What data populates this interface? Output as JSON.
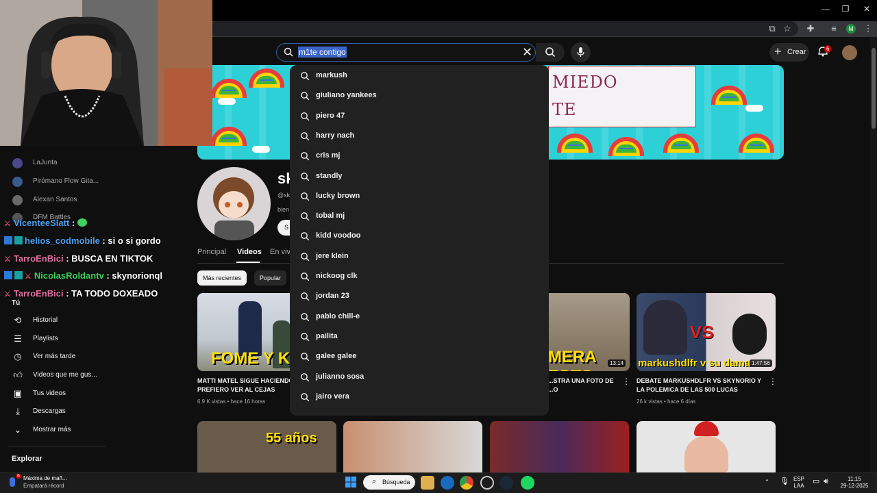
{
  "browser": {
    "window_controls": [
      "—",
      "❐",
      "✕"
    ],
    "profile_initial": "M"
  },
  "youtube": {
    "search_query": "m1te contigo",
    "create_label": "Crear",
    "notifications_count": "6"
  },
  "suggestions": [
    "markush",
    "giuliano yankees",
    "piero 47",
    "harry nach",
    "cris mj",
    "standly",
    "lucky brown",
    "tobal mj",
    "kidd voodoo",
    "jere klein",
    "nickoog clk",
    "jordan 23",
    "pablo chill-e",
    "pailita",
    "galee galee",
    "julianno sosa",
    "jairo vera"
  ],
  "banner": {
    "text_line1": "MIEDO",
    "text_line2": "TE"
  },
  "channel": {
    "name_partial": "sk",
    "handle_partial": "@sk",
    "desc_partial": "bien",
    "subscribe_partial": "S"
  },
  "tabs": [
    "Principal",
    "Videos",
    "En viv"
  ],
  "chips": [
    "Más recientes",
    "Popular"
  ],
  "sidebar": {
    "subscriptions": [
      {
        "label": "LaJunta"
      },
      {
        "label": "Pirómano Flow Gita..."
      },
      {
        "label": "Alexan Santos"
      },
      {
        "label": "DFM Battles"
      }
    ],
    "you_header": "Tú",
    "you_items": [
      {
        "label": "Historial",
        "icon": "history-icon"
      },
      {
        "label": "Playlists",
        "icon": "playlists-icon"
      },
      {
        "label": "Ver más tarde",
        "icon": "watch-later-icon"
      },
      {
        "label": "Videos que me gus...",
        "icon": "liked-icon"
      },
      {
        "label": "Tus videos",
        "icon": "your-videos-icon"
      },
      {
        "label": "Descargas",
        "icon": "downloads-icon"
      },
      {
        "label": "Mostrar más",
        "icon": "chevron-down-icon"
      }
    ],
    "explore_header": "Explorar"
  },
  "chat": [
    {
      "name": "VicenteeSlatt",
      "sep": " : ",
      "msg": ""
    },
    {
      "name": "helios_codmobile",
      "sep": " : ",
      "msg": "si o si gordo"
    },
    {
      "name": "TarroEnBici",
      "sep": " : ",
      "msg": "BUSCA EN TIKTOK"
    },
    {
      "name": "NicolasRoldantv",
      "sep": " : ",
      "msg": "skynorionql"
    },
    {
      "name": "TarroEnBici",
      "sep": " : ",
      "msg": "TA TODO DOXEADO"
    }
  ],
  "videos": [
    {
      "title": "MATTI MATEL SIGUE HACIENDO FOMES PREFIERO VER AL CEJAS",
      "meta": "6.9 K vistas • hace 16 horas",
      "caption": "FOME Y K"
    },
    {
      "title": "...STRA UNA FOTO DE ...O",
      "meta": "",
      "caption": "MERA FOTO",
      "duration": "13:14"
    },
    {
      "title": "DEBATE MARKUSHDLFR VS SKYNORIO Y LA POLEMICA DE LAS 500 LUCAS",
      "meta": "26 k vistas • hace 6 días",
      "caption": "markushdlfr v su dama",
      "duration": "1:47:56"
    }
  ],
  "row2_captions": [
    "55 años"
  ],
  "taskbar": {
    "weather_title": "Máxima de mañ...",
    "weather_sub": "Empatará récord",
    "weather_badge": "6",
    "search_label": "Búsqueda",
    "lang_1": "ESP",
    "lang_2": "LAA",
    "time": "11:15",
    "date": "29-12-2025"
  }
}
